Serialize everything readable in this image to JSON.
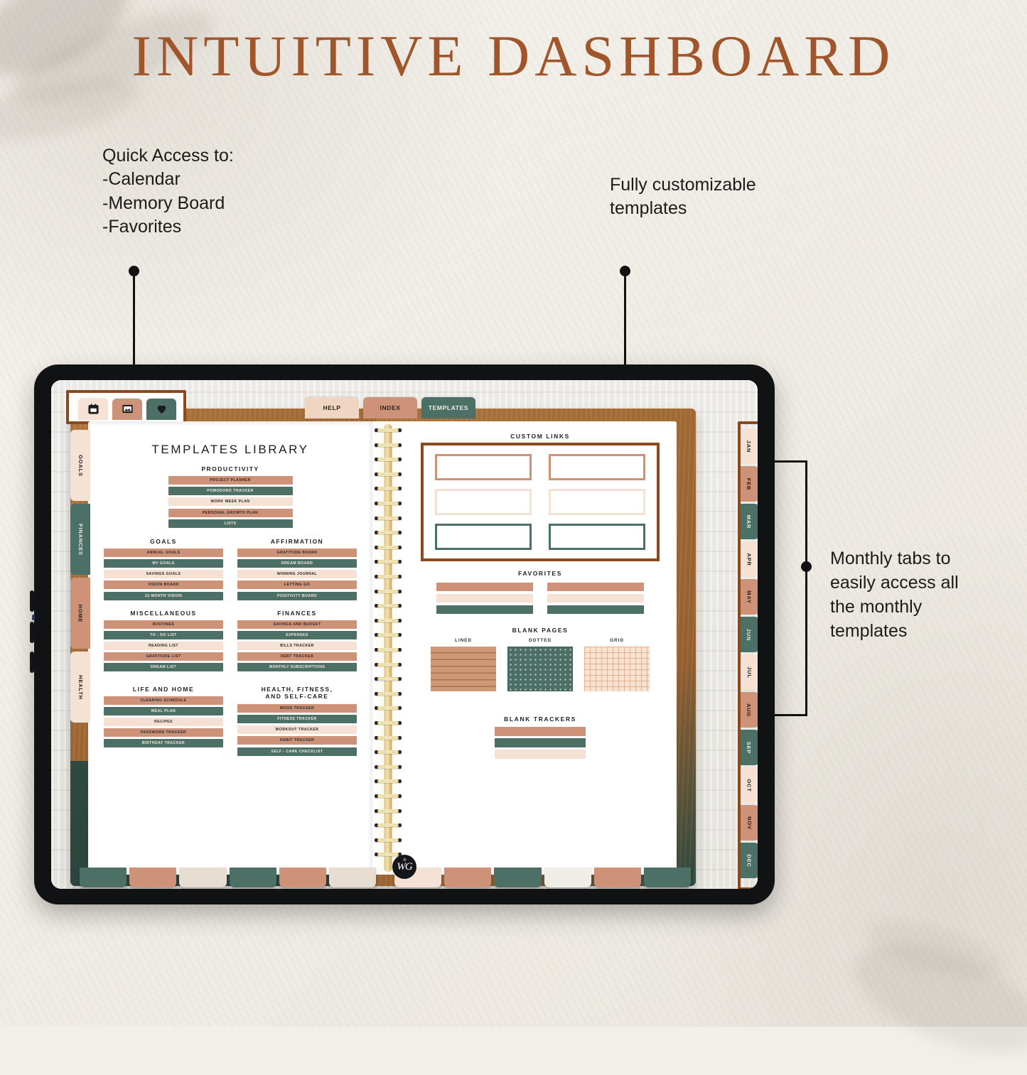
{
  "headline": "INTUITIVE DASHBOARD",
  "annotations": {
    "left": "Quick Access to:\n-Calendar\n-Memory Board\n-Favorites",
    "middle": "Fully customizable\ntemplates",
    "right": "Monthly tabs to\neasily access all\nthe monthly\ntemplates"
  },
  "colors": {
    "terracotta": "#ce9279",
    "green": "#4c6f66",
    "cream": "#f5e2d4",
    "brown_frame": "#8a4a1c",
    "headline": "#a0552a"
  },
  "planner": {
    "quick_icons": [
      {
        "name": "calendar-icon",
        "color": "#f5e2d4"
      },
      {
        "name": "memory-board-icon",
        "color": "#ce9279"
      },
      {
        "name": "favorites-heart-icon",
        "color": "#4c6f66"
      }
    ],
    "menu_tabs": [
      {
        "label": "HELP",
        "color": "#f0d6c2"
      },
      {
        "label": "INDEX",
        "color": "#ce9279"
      },
      {
        "label": "TEMPLATES",
        "color": "#4c6f66"
      }
    ],
    "side_tabs_left": [
      {
        "label": "GOALS",
        "color": "#f5e2d4"
      },
      {
        "label": "FINANCES",
        "color": "#4c6f66"
      },
      {
        "label": "HOME",
        "color": "#ce9279"
      },
      {
        "label": "HEALTH",
        "color": "#f5e2d4"
      }
    ],
    "side_tabs_right": [
      {
        "label": "JAN",
        "color": "#f5e2d4"
      },
      {
        "label": "FEB",
        "color": "#ce9279"
      },
      {
        "label": "MAR",
        "color": "#4c6f66"
      },
      {
        "label": "APR",
        "color": "#f5e2d4"
      },
      {
        "label": "MAY",
        "color": "#ce9279"
      },
      {
        "label": "JUN",
        "color": "#4c6f66"
      },
      {
        "label": "JUL",
        "color": "#f5e2d4"
      },
      {
        "label": "AUG",
        "color": "#ce9279"
      },
      {
        "label": "SEP",
        "color": "#4c6f66"
      },
      {
        "label": "OCT",
        "color": "#f5e2d4"
      },
      {
        "label": "NOV",
        "color": "#ce9279"
      },
      {
        "label": "DEC",
        "color": "#4c6f66"
      }
    ],
    "bottom_tabs_left": [
      "#4c6f66",
      "#ce9279",
      "#e7ded1",
      "#4c6f66",
      "#ce9279",
      "#e7ded1"
    ],
    "bottom_tabs_right": [
      "#f5e2d4",
      "#ce9279",
      "#4c6f66",
      "#f0ece6",
      "#ce9279",
      "#4c6f66"
    ],
    "left_page": {
      "title": "TEMPLATES LIBRARY",
      "sections": [
        {
          "heading": "PRODUCTIVITY",
          "full_width": true,
          "items": [
            {
              "label": "PROJECT PLANNER",
              "color": "#ce9279"
            },
            {
              "label": "POMODORO TRACKER",
              "color": "#4c6f66"
            },
            {
              "label": "WORK WEEK PLAN",
              "color": "#f5e2d4"
            },
            {
              "label": "PERSONAL GROWTH PLAN",
              "color": "#ce9279"
            },
            {
              "label": "LISTS",
              "color": "#4c6f66"
            }
          ]
        },
        {
          "heading": "GOALS",
          "items": [
            {
              "label": "ANNUAL GOALS",
              "color": "#ce9279"
            },
            {
              "label": "MY GOALS",
              "color": "#4c6f66"
            },
            {
              "label": "SAVINGS GOALS",
              "color": "#f5e2d4"
            },
            {
              "label": "VISION BOARD",
              "color": "#ce9279"
            },
            {
              "label": "12-MONTH VISION",
              "color": "#4c6f66"
            }
          ]
        },
        {
          "heading": "AFFIRMATION",
          "items": [
            {
              "label": "GRATITUDE BOARD",
              "color": "#ce9279"
            },
            {
              "label": "DREAM BOARD",
              "color": "#4c6f66"
            },
            {
              "label": "WINNING JOURNAL",
              "color": "#f5e2d4"
            },
            {
              "label": "LETTING GO",
              "color": "#ce9279"
            },
            {
              "label": "POSITIVITY BOARD",
              "color": "#4c6f66"
            }
          ]
        },
        {
          "heading": "MISCELLANEOUS",
          "items": [
            {
              "label": "ROUTINES",
              "color": "#ce9279"
            },
            {
              "label": "TO - DO LIST",
              "color": "#4c6f66"
            },
            {
              "label": "READING LIST",
              "color": "#f5e2d4"
            },
            {
              "label": "GRATITUDE LIST",
              "color": "#ce9279"
            },
            {
              "label": "DREAM LIST",
              "color": "#4c6f66"
            }
          ]
        },
        {
          "heading": "FINANCES",
          "items": [
            {
              "label": "SAVINGS AND BUDGET",
              "color": "#ce9279"
            },
            {
              "label": "EXPENSES",
              "color": "#4c6f66"
            },
            {
              "label": "BILLS TRACKER",
              "color": "#f5e2d4"
            },
            {
              "label": "DEBT TRACKER",
              "color": "#ce9279"
            },
            {
              "label": "MONTHLY SUBSCRIPTIONS",
              "color": "#4c6f66"
            }
          ]
        },
        {
          "heading": "LIFE AND HOME",
          "items": [
            {
              "label": "CLEANING SCHEDULE",
              "color": "#ce9279"
            },
            {
              "label": "MEAL PLAN",
              "color": "#4c6f66"
            },
            {
              "label": "RECIPES",
              "color": "#f5e2d4"
            },
            {
              "label": "PASSWORD TRACKER",
              "color": "#ce9279"
            },
            {
              "label": "BIRTHDAY TRACKER",
              "color": "#4c6f66"
            }
          ]
        },
        {
          "heading": "HEALTH, FITNESS,\nAND SELF-CARE",
          "items": [
            {
              "label": "MOOD TRACKER",
              "color": "#ce9279"
            },
            {
              "label": "FITNESS TRACKER",
              "color": "#4c6f66"
            },
            {
              "label": "WORKOUT TRACKER",
              "color": "#f5e2d4"
            },
            {
              "label": "HABIT TRACKER",
              "color": "#ce9279"
            },
            {
              "label": "SELF - CARE CHECKLIST",
              "color": "#4c6f66"
            }
          ]
        }
      ]
    },
    "right_page": {
      "custom_links": {
        "title": "CUSTOM LINKS",
        "cells": [
          {
            "border": "#ce9279"
          },
          {
            "border": "#ce9279"
          },
          {
            "border": "#f5e2d4"
          },
          {
            "border": "#f5e2d4"
          },
          {
            "border": "#4c6f66"
          },
          {
            "border": "#4c6f66"
          }
        ]
      },
      "favorites": {
        "title": "FAVORITES",
        "bars": [
          "#ce9279",
          "#ce9279",
          "#f5e2d4",
          "#f5e2d4",
          "#4c6f66",
          "#4c6f66"
        ]
      },
      "blank_pages": {
        "title": "BLANK PAGES",
        "items": [
          {
            "label": "LINED",
            "style": "bp-lined"
          },
          {
            "label": "DOTTED",
            "style": "bp-dotted"
          },
          {
            "label": "GRID",
            "style": "bp-grid"
          }
        ]
      },
      "blank_trackers": {
        "title": "BLANK TRACKERS",
        "bars": [
          "#ce9279",
          "#4c6f66",
          "#f5e2d4"
        ]
      }
    },
    "logo": "WG"
  }
}
